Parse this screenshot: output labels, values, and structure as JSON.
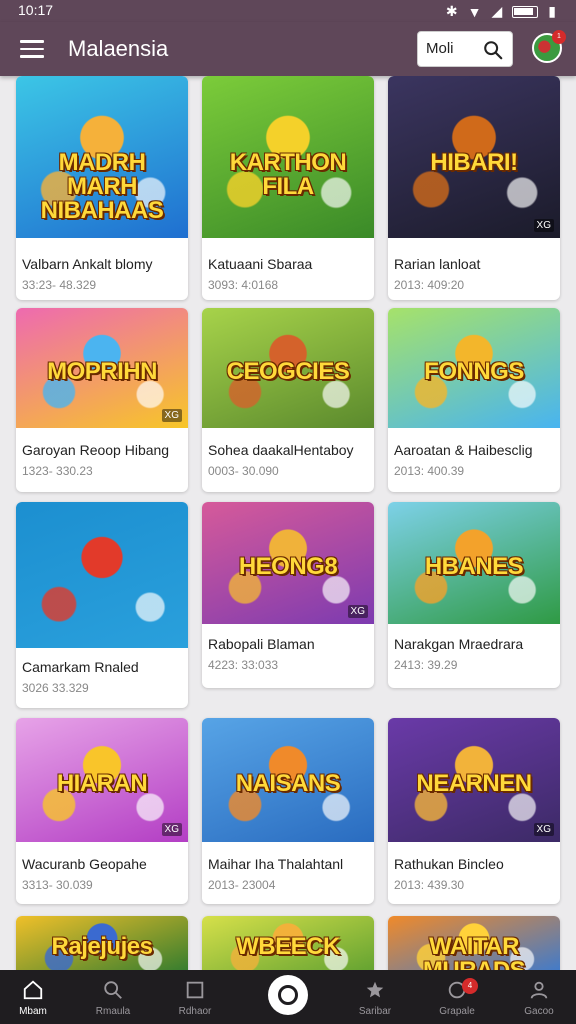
{
  "status": {
    "time": "10:17"
  },
  "header": {
    "title": "Malaensia",
    "search_value": "Moli",
    "avatar_badge": "1"
  },
  "cards": [
    {
      "title": "Valbarn Ankalt blomy",
      "meta": "33:23- 48.329",
      "overtext": "MADRH MARH NIBAHAAS",
      "tag": "",
      "colors": [
        "#1f6fd0",
        "#3cc6e6",
        "#f5b13a"
      ]
    },
    {
      "title": "Katuaani Sbaraa",
      "meta": "3093: 4:0168",
      "overtext": "KARTHON FILA",
      "tag": "",
      "colors": [
        "#3a8a28",
        "#7ccc3a",
        "#f4d12a"
      ]
    },
    {
      "title": "Rarian lanloat",
      "meta": "2013: 409:20",
      "overtext": "HIBARI!",
      "tag": "XG",
      "colors": [
        "#1b1b2a",
        "#3b3560",
        "#d06a1a"
      ]
    },
    {
      "title": "Garoyan Reoop Hibang",
      "meta": "1323- 330.23",
      "overtext": "MOPRIHN",
      "tag": "XG",
      "colors": [
        "#f7c628",
        "#ee6ab0",
        "#4bb4f0"
      ]
    },
    {
      "title": "Sohea daakalHentaboy",
      "meta": "0003- 30.090",
      "overtext": "CEOGCIES",
      "tag": "",
      "colors": [
        "#5b8a2d",
        "#a7d34a",
        "#d4622b"
      ]
    },
    {
      "title": "Aaroatan & Haibesclig",
      "meta": "2013: 400.39",
      "overtext": "FONNGS",
      "tag": "",
      "colors": [
        "#48b4f0",
        "#a6e26a",
        "#f3b62b"
      ]
    },
    {
      "title": "Camarkam Rnaled",
      "meta": "3026 33.329",
      "overtext": "",
      "tag": "",
      "colors": [
        "#2aa0dc",
        "#1c8fd0",
        "#e23a2a"
      ]
    },
    {
      "title": "Rabopali Blaman",
      "meta": "4223: 33:033",
      "overtext": "HEONG8",
      "tag": "XG",
      "colors": [
        "#7d3bb0",
        "#d65a9a",
        "#f0b23a"
      ]
    },
    {
      "title": "Narakgan Mraedrara",
      "meta": "2413: 39.29",
      "overtext": "HBANES",
      "tag": "",
      "colors": [
        "#2f9a44",
        "#7dd1e8",
        "#f3a22b"
      ]
    },
    {
      "title": "Wacuranb Geopahe",
      "meta": "3313- 30.039",
      "overtext": "HIARAN",
      "tag": "XG",
      "colors": [
        "#b33ec4",
        "#e7a3e8",
        "#f9c52a"
      ]
    },
    {
      "title": "Maihar Iha Thalahtanl",
      "meta": "2013- 23004",
      "overtext": "NAISANS",
      "tag": "",
      "colors": [
        "#2a6cc0",
        "#57a4e6",
        "#f08a2a"
      ]
    },
    {
      "title": "Rathukan Bincleo",
      "meta": "2013: 439.30",
      "overtext": "NEARNEN",
      "tag": "XG",
      "colors": [
        "#3c2a66",
        "#6a3aa8",
        "#f2b33a"
      ]
    },
    {
      "title": "",
      "meta": "",
      "overtext": "Rajejujes",
      "tag": "",
      "colors": [
        "#2e7a2e",
        "#f0c02a",
        "#3a6ad0"
      ]
    },
    {
      "title": "",
      "meta": "",
      "overtext": "WBEECK",
      "tag": "",
      "colors": [
        "#5fa030",
        "#d6e04a",
        "#f2b13a"
      ]
    },
    {
      "title": "",
      "meta": "",
      "overtext": "WAITAR MURADS",
      "tag": "",
      "colors": [
        "#3a7ad0",
        "#f08a2a",
        "#ffd23a"
      ]
    }
  ],
  "bottom_nav": {
    "items": [
      {
        "label": "Mbam",
        "icon": "home-icon"
      },
      {
        "label": "Rmaula",
        "icon": "search-icon"
      },
      {
        "label": "Rdhaor",
        "icon": "square-icon"
      },
      {
        "label": "Saribar",
        "icon": "star-icon"
      },
      {
        "label": "Grapale",
        "icon": "chat-icon"
      },
      {
        "label": "Gacoo",
        "icon": "profile-icon"
      }
    ],
    "badge": "4"
  }
}
